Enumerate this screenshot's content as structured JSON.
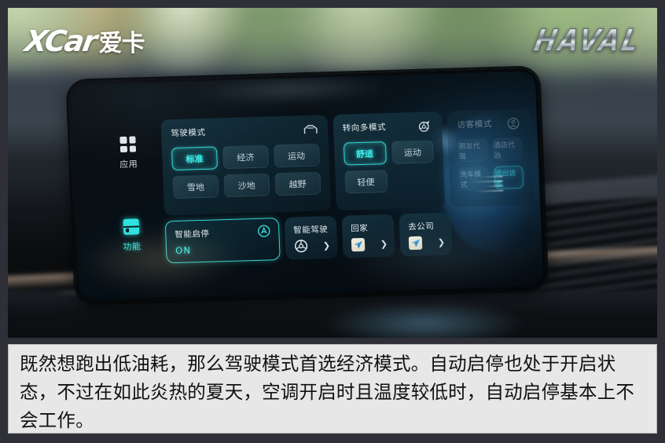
{
  "watermarks": {
    "left_logo_latin": "XCar",
    "left_logo_cn": "爱卡",
    "right_logo": "HAVAL"
  },
  "headunit": {
    "sidebar": {
      "items": [
        {
          "label": "应用",
          "icon": "grid-apps-icon",
          "active": false
        },
        {
          "label": "功能",
          "icon": "functions-icon",
          "active": true
        }
      ]
    },
    "panels": [
      {
        "id": "driving-mode",
        "title": "驾驶模式",
        "icon": "car-front-icon",
        "enabled": true,
        "options": [
          {
            "label": "标准",
            "selected": true
          },
          {
            "label": "经济",
            "selected": false
          },
          {
            "label": "运动",
            "selected": false
          },
          {
            "label": "雪地",
            "selected": false
          },
          {
            "label": "沙地",
            "selected": false
          },
          {
            "label": "越野",
            "selected": false
          }
        ]
      },
      {
        "id": "steering-multi-mode",
        "title": "转向多模式",
        "icon": "steering-arrow-icon",
        "enabled": true,
        "options": [
          {
            "label": "舒适",
            "selected": true
          },
          {
            "label": "运动",
            "selected": false
          },
          {
            "label": "轻便",
            "selected": false
          }
        ]
      },
      {
        "id": "guest-mode",
        "title": "访客模式",
        "icon": "user-circle-icon",
        "enabled": false,
        "options": [
          {
            "label": "朋友代驾",
            "selected": false
          },
          {
            "label": "酒店代泊",
            "selected": false
          },
          {
            "label": "洗车模式",
            "selected": false
          },
          {
            "label": "退出访客",
            "selected": true
          }
        ]
      }
    ],
    "tiles": [
      {
        "id": "auto-start-stop",
        "title": "智能启停",
        "value": "ON",
        "badge_icon": "auto-a-circle-icon",
        "highlighted": true
      },
      {
        "id": "intelligent-driving",
        "title": "智能驾驶",
        "icon": "steering-wheel-icon",
        "chevron": "❯",
        "highlighted": false
      },
      {
        "id": "nav-home",
        "title": "回家",
        "icon": "navigation-arrow-icon",
        "chevron": "❯",
        "highlighted": false
      },
      {
        "id": "nav-office",
        "title": "去公司",
        "icon": "navigation-arrow-icon",
        "chevron": "❯",
        "highlighted": false
      }
    ]
  },
  "caption": {
    "text": "既然想跑出低油耗，那么驾驶模式首选经济模式。自动启停也处于开启状态，不过在如此炎热的夏天，空调开启时且温度较低时，自动启停基本上不会工作。"
  },
  "colors": {
    "accent_cyan": "#3ef0ea",
    "panel_bg": "#183a48",
    "screen_bg": "#04090e",
    "caption_bg": "#e7e7e7",
    "copper_trim": "#c9855c"
  }
}
